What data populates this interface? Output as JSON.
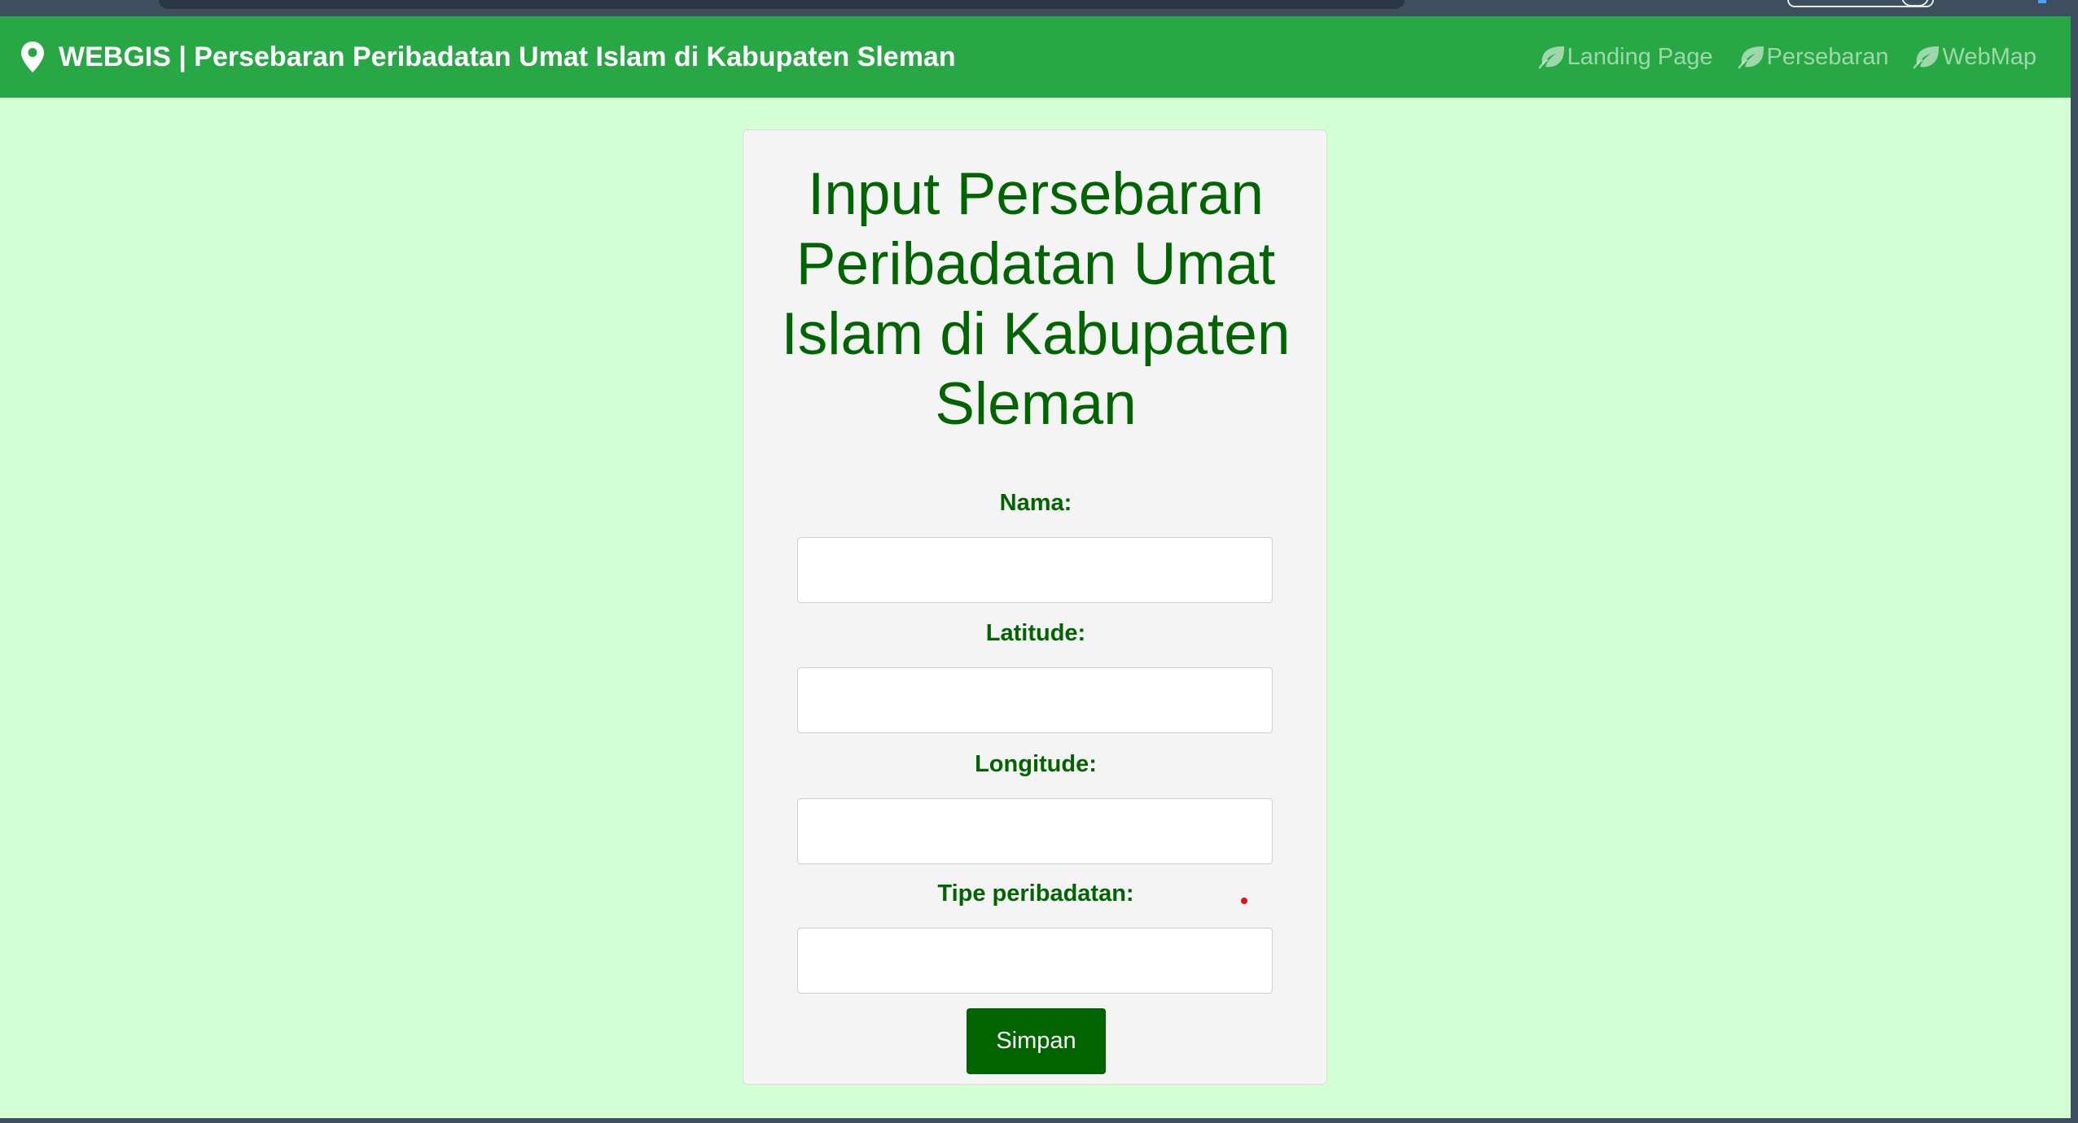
{
  "navbar": {
    "brand_icon": "map-marker-icon",
    "brand_text": "WEBGIS | Persebaran Peribadatan Umat Islam di Kabupaten Sleman",
    "link_icon": "leaf-icon",
    "links": [
      {
        "label": "Landing Page"
      },
      {
        "label": "Persebaran"
      },
      {
        "label": "WebMap"
      }
    ]
  },
  "form": {
    "title_lines": [
      "Input Persebaran",
      "Peribadatan Umat",
      "Islam di Kabupaten",
      "Sleman"
    ],
    "fields": [
      {
        "label": "Nama:",
        "value": ""
      },
      {
        "label": "Latitude:",
        "value": ""
      },
      {
        "label": "Longitude:",
        "value": ""
      },
      {
        "label": "Tipe peribadatan:",
        "value": ""
      }
    ],
    "submit_label": "Simpan"
  },
  "colors": {
    "navbar": "#28a745",
    "page_background": "#d3fdd3",
    "text_dark_green": "#006400",
    "button": "#006400"
  }
}
